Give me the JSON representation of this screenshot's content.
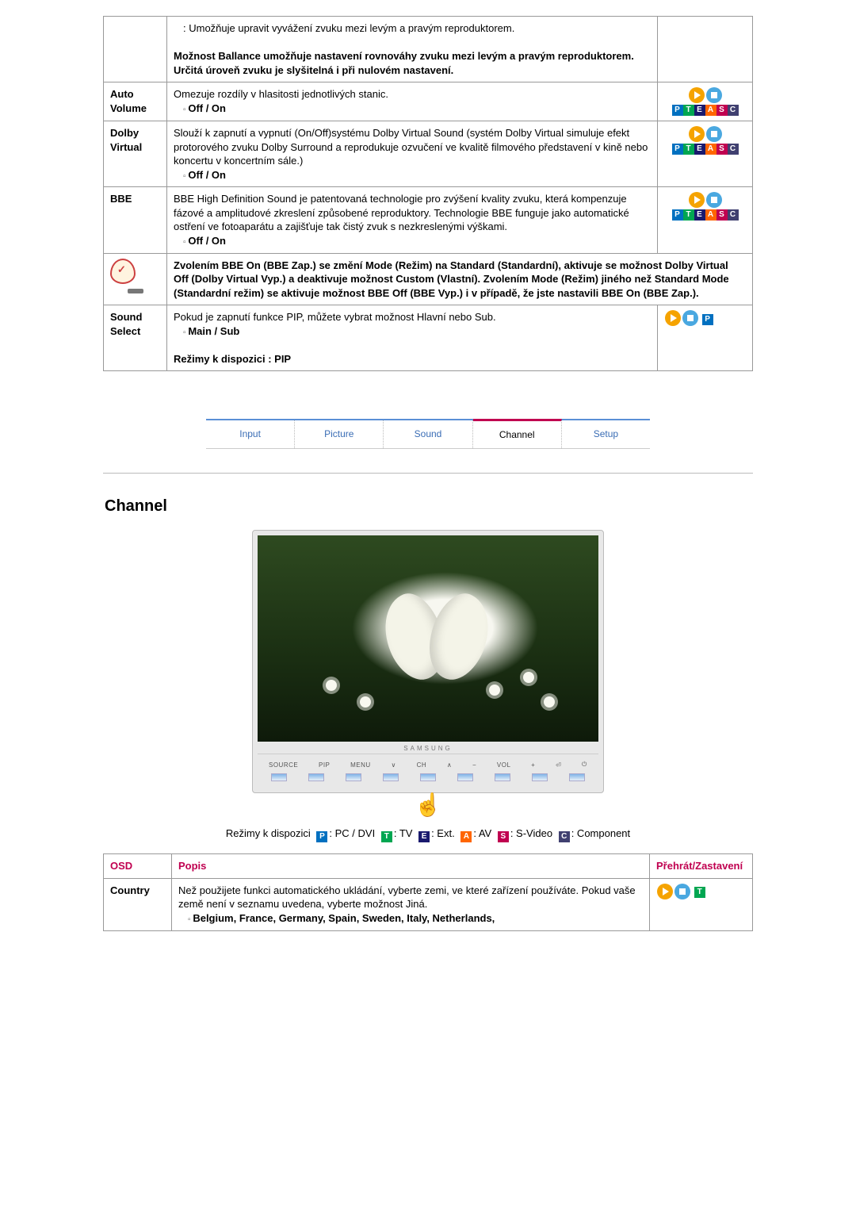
{
  "top_table": {
    "rows": [
      {
        "label": "",
        "desc_plain": ": Umožňuje upravit vyvážení zvuku mezi levým a pravým reproduktorem.",
        "desc_bold": "Možnost Ballance umožňuje nastavení rovnováhy zvuku mezi levým a pravým reproduktorem. Určitá úroveň zvuku je slyšitelná i při nulovém nastavení.",
        "icons": null
      },
      {
        "label": "Auto Volume",
        "desc_plain": "Omezuje rozdíly v hlasitosti jednotlivých stanic.",
        "desc_bullet": "Off / On",
        "icons": "PTEASC"
      },
      {
        "label": "Dolby Virtual",
        "desc_plain": "Slouží k zapnutí a vypnutí (On/Off)systému Dolby Virtual Sound (systém Dolby Virtual simuluje efekt protorového zvuku Dolby Surround a reprodukuje ozvučení ve kvalitě filmového představení v kině nebo koncertu v koncertním sále.)",
        "desc_bullet": "Off / On",
        "icons": "PTEASC"
      },
      {
        "label": "BBE",
        "desc_plain": "BBE High Definition Sound je patentovaná technologie pro zvýšení kvality zvuku, která kompenzuje fázové a amplitudové zkreslení způsobené reproduktory. Technologie BBE funguje jako automatické ostření ve fotoaparátu a zajišťuje tak čistý zvuk s nezkreslenými výškami.",
        "desc_bullet": "Off / On",
        "icons": "PTEASC"
      }
    ],
    "note": "Zvolením BBE On (BBE Zap.) se změní Mode (Režim) na Standard (Standardní), aktivuje se možnost Dolby Virtual Off (Dolby Virtual Vyp.) a deaktivuje možnost Custom (Vlastní). Zvolením Mode (Režim) jiného než Standard Mode (Standardní režim) se aktivuje možnost BBE Off (BBE Vyp.) i v případě, že jste nastavili BBE On (BBE Zap.).",
    "sound_select": {
      "label": "Sound Select",
      "desc_plain": "Pokud je zapnutí funkce PIP, můžete vybrat možnost Hlavní nebo Sub.",
      "desc_bullet": "Main / Sub",
      "desc_bold2": "Režimy k dispozici : PIP",
      "icons": "P"
    }
  },
  "tabs": {
    "items": [
      "Input",
      "Picture",
      "Sound",
      "Channel",
      "Setup"
    ],
    "active_index": 3
  },
  "section_title": "Channel",
  "monitor": {
    "brand": "SAMSUNG",
    "buttons": [
      "SOURCE",
      "PIP",
      "MENU",
      "∨",
      "CH",
      "∧",
      "−",
      "VOL",
      "+",
      "⏎",
      "⏻"
    ]
  },
  "modes_line": {
    "prefix": "Režimy k dispozici",
    "items": [
      {
        "tag": "P",
        "label": ": PC / DVI"
      },
      {
        "tag": "T",
        "label": ": TV"
      },
      {
        "tag": "E",
        "label": ": Ext."
      },
      {
        "tag": "A",
        "label": ": AV"
      },
      {
        "tag": "S",
        "label": ": S-Video"
      },
      {
        "tag": "C",
        "label": ": Component"
      }
    ]
  },
  "bottom_table": {
    "headers": {
      "osd": "OSD",
      "desc": "Popis",
      "play": "Přehrát/Zastavení"
    },
    "row": {
      "label": "Country",
      "desc_plain": "Než použijete funkci automatického ukládání, vyberte zemi, ve které zařízení používáte. Pokud vaše země není v seznamu uvedena, vyberte možnost Jiná.",
      "desc_bullet": "Belgium, France, Germany, Spain, Sweden, Italy, Netherlands,",
      "icons": "T"
    }
  }
}
